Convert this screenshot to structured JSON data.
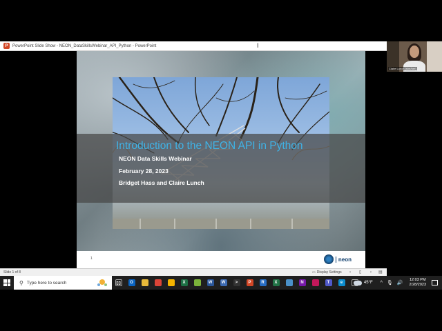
{
  "window": {
    "title": "PowerPoint Slide Show - NEON_DataSkillsWebinar_API_Python - PowerPoint"
  },
  "slide": {
    "title": "Introduction to the NEON API in Python",
    "subtitle_series": "NEON Data Skills Webinar",
    "subtitle_date": "February 28, 2023",
    "subtitle_presenters": "Bridget Hass and Claire Lunch",
    "footer_number": "1",
    "logo_text": "neon",
    "title_color": "#3fb3e6"
  },
  "status_bar": {
    "slide_indicator": "Slide 1 of 8",
    "display_settings": "Display Settings"
  },
  "video": {
    "participant_label": "Claire Lunch (she/her)"
  },
  "taskbar": {
    "search_placeholder": "Type here to search",
    "weather_temp": "45°F",
    "time": "12:03 PM",
    "date": "2/28/2023",
    "apps": [
      {
        "name": "task-view-icon",
        "glyph": "▯▯",
        "color": "#1f1f1f"
      },
      {
        "name": "outlook-icon",
        "glyph": "O",
        "color": "#0a64c2"
      },
      {
        "name": "file-explorer-icon",
        "glyph": "",
        "color": "#e8b93a"
      },
      {
        "name": "chrome-icon",
        "glyph": "",
        "color": "#db4437"
      },
      {
        "name": "chrome-profile-icon",
        "glyph": "",
        "color": "#f4b400"
      },
      {
        "name": "excel-file-icon",
        "glyph": "X",
        "color": "#1d7044"
      },
      {
        "name": "color-app-icon",
        "glyph": "",
        "color": "#7bb33a"
      },
      {
        "name": "word-icon",
        "glyph": "W",
        "color": "#2b579a"
      },
      {
        "name": "word-doc-icon",
        "glyph": "W",
        "color": "#3d6bb3"
      },
      {
        "name": "terminal-icon",
        "glyph": ">",
        "color": "#333333"
      },
      {
        "name": "powerpoint-icon",
        "glyph": "P",
        "color": "#d24726"
      },
      {
        "name": "r-icon",
        "glyph": "R",
        "color": "#276dc3"
      },
      {
        "name": "excel-icon",
        "glyph": "X",
        "color": "#217346"
      },
      {
        "name": "app-icon",
        "glyph": "",
        "color": "#4a90c8"
      },
      {
        "name": "onenote-icon",
        "glyph": "N",
        "color": "#7719aa"
      },
      {
        "name": "snipping-icon",
        "glyph": "",
        "color": "#c2185b"
      },
      {
        "name": "teams-icon",
        "glyph": "T",
        "color": "#5059c9"
      },
      {
        "name": "edge-icon",
        "glyph": "e",
        "color": "#0c8dce"
      },
      {
        "name": "overflow-icon",
        "glyph": "▾",
        "color": "#1f1f1f"
      }
    ]
  }
}
